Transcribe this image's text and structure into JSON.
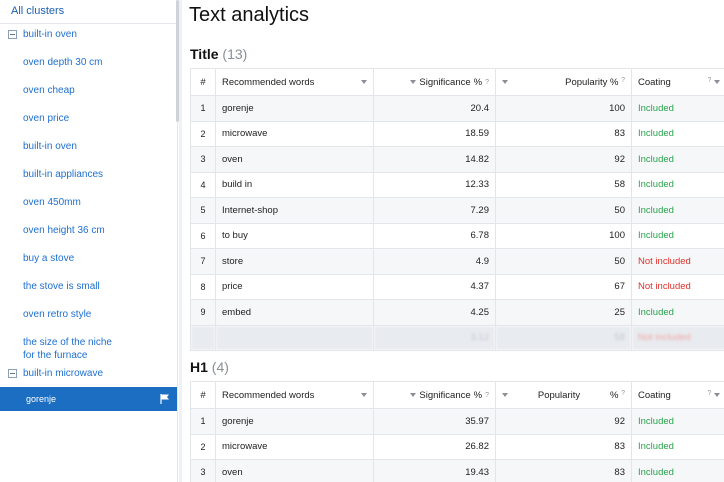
{
  "sidebar": {
    "all_clusters": "All clusters",
    "group1": "built-in oven",
    "items": [
      "oven depth 30 cm",
      "oven cheap",
      "oven price",
      "built-in oven",
      "built-in appliances",
      "oven 450mm",
      "oven height 36 cm",
      "buy a stove",
      "the stove is small",
      "oven retro style",
      "the size of the niche\nfor the furnace"
    ],
    "group2": "built-in microwave",
    "selected": "gorenje",
    "selected_icon": "flag-icon"
  },
  "page_title": "Text analytics",
  "columns": {
    "num": "#",
    "words": "Recommended words",
    "significance": "Significance",
    "popularity": "Popularity",
    "coating": "Coating",
    "percent": "%",
    "help": "?"
  },
  "title_section": {
    "label": "Title",
    "count": "(13)",
    "rows": [
      {
        "n": "1",
        "word": "gorenje",
        "sig": "20.4",
        "pop": "100",
        "coat": "Included"
      },
      {
        "n": "2",
        "word": "microwave",
        "sig": "18.59",
        "pop": "83",
        "coat": "Included"
      },
      {
        "n": "3",
        "word": "oven",
        "sig": "14.82",
        "pop": "92",
        "coat": "Included"
      },
      {
        "n": "4",
        "word": "build in",
        "sig": "12.33",
        "pop": "58",
        "coat": "Included"
      },
      {
        "n": "5",
        "word": "Internet-shop",
        "sig": "7.29",
        "pop": "50",
        "coat": "Included"
      },
      {
        "n": "6",
        "word": "to buy",
        "sig": "6.78",
        "pop": "100",
        "coat": "Included"
      },
      {
        "n": "7",
        "word": "store",
        "sig": "4.9",
        "pop": "50",
        "coat": "Not included"
      },
      {
        "n": "8",
        "word": "price",
        "sig": "4.37",
        "pop": "67",
        "coat": "Not included"
      },
      {
        "n": "9",
        "word": "embed",
        "sig": "4.25",
        "pop": "25",
        "coat": "Included"
      }
    ],
    "blurred": {
      "sig": "3.12",
      "pop": "58",
      "coat": "Not included"
    }
  },
  "h1_section": {
    "label": "H1",
    "count": "(4)",
    "rows": [
      {
        "n": "1",
        "word": "gorenje",
        "sig": "35.97",
        "pop": "92",
        "coat": "Included"
      },
      {
        "n": "2",
        "word": "microwave",
        "sig": "26.82",
        "pop": "83",
        "coat": "Included"
      },
      {
        "n": "3",
        "word": "oven",
        "sig": "19.43",
        "pop": "83",
        "coat": "Included"
      }
    ]
  },
  "colors": {
    "included": "#27a34a",
    "not_included": "#e0312b",
    "accent": "#1b6ec2"
  }
}
